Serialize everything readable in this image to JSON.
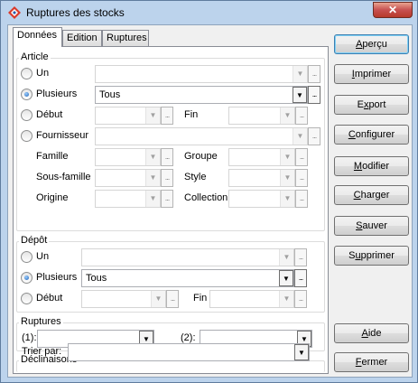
{
  "window": {
    "title": "Ruptures des stocks",
    "close_label": "✕"
  },
  "tabs": [
    {
      "label": "Données"
    },
    {
      "label": "Edition"
    },
    {
      "label": "Ruptures"
    }
  ],
  "article": {
    "title": "Article",
    "un_label": "Un",
    "plusieurs_label": "Plusieurs",
    "plusieurs_value": "Tous",
    "debut_label": "Début",
    "fin_label": "Fin",
    "fournisseur_label": "Fournisseur",
    "famille_label": "Famille",
    "groupe_label": "Groupe",
    "sousfamille_label": "Sous-famille",
    "style_label": "Style",
    "origine_label": "Origine",
    "collection_label": "Collection",
    "selected": "plusieurs"
  },
  "depot": {
    "title": "Dépôt",
    "un_label": "Un",
    "plusieurs_label": "Plusieurs",
    "plusieurs_value": "Tous",
    "debut_label": "Début",
    "fin_label": "Fin",
    "selected": "plusieurs"
  },
  "ruptures": {
    "title": "Ruptures",
    "label1": "(1):",
    "label2": "(2):"
  },
  "declinaisons": {
    "title": "Déclinaisons",
    "trier_label": "Trier par:"
  },
  "buttons": {
    "apercu": {
      "m": "A",
      "rest": "perçu"
    },
    "imprimer": {
      "m": "I",
      "rest": "mprimer"
    },
    "export": {
      "pre": "E",
      "m": "x",
      "rest": "port"
    },
    "configurer": {
      "m": "C",
      "rest": "onfigurer"
    },
    "modifier": {
      "m": "M",
      "rest": "odifier"
    },
    "charger": {
      "m": "C",
      "rest": "harger"
    },
    "sauver": {
      "m": "S",
      "rest": "auver"
    },
    "supprimer": {
      "pre": "S",
      "m": "u",
      "rest": "pprimer"
    },
    "aide": {
      "m": "A",
      "rest": "ide"
    },
    "fermer": {
      "m": "F",
      "rest": "ermer"
    }
  },
  "icons": {
    "dropdown": "▼",
    "ellipsis": "..."
  }
}
